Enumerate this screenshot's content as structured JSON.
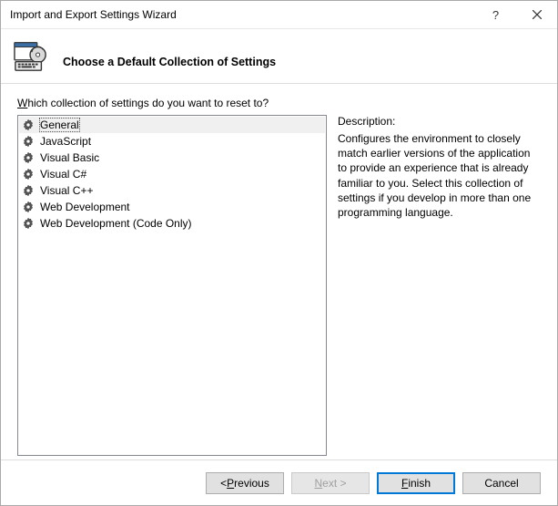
{
  "window": {
    "title": "Import and Export Settings Wizard",
    "help_glyph": "?",
    "heading": "Choose a Default Collection of Settings"
  },
  "prompt": {
    "pre": "W",
    "rest": "hich collection of settings do you want to reset to?"
  },
  "items": [
    {
      "label": "General",
      "selected": true
    },
    {
      "label": "JavaScript",
      "selected": false
    },
    {
      "label": "Visual Basic",
      "selected": false
    },
    {
      "label": "Visual C#",
      "selected": false
    },
    {
      "label": "Visual C++",
      "selected": false
    },
    {
      "label": "Web Development",
      "selected": false
    },
    {
      "label": "Web Development (Code Only)",
      "selected": false
    }
  ],
  "description": {
    "label": "Description:",
    "text": "Configures the environment to closely match earlier versions of the application to provide an experience that is already familiar to you. Select this collection of settings if you develop in more than one programming language."
  },
  "buttons": {
    "previous": {
      "pre": "< ",
      "mn": "P",
      "post": "revious"
    },
    "next": {
      "pre": "",
      "mn": "N",
      "post": "ext >"
    },
    "finish": {
      "pre": "",
      "mn": "F",
      "post": "inish"
    },
    "cancel": {
      "label": "Cancel"
    }
  }
}
